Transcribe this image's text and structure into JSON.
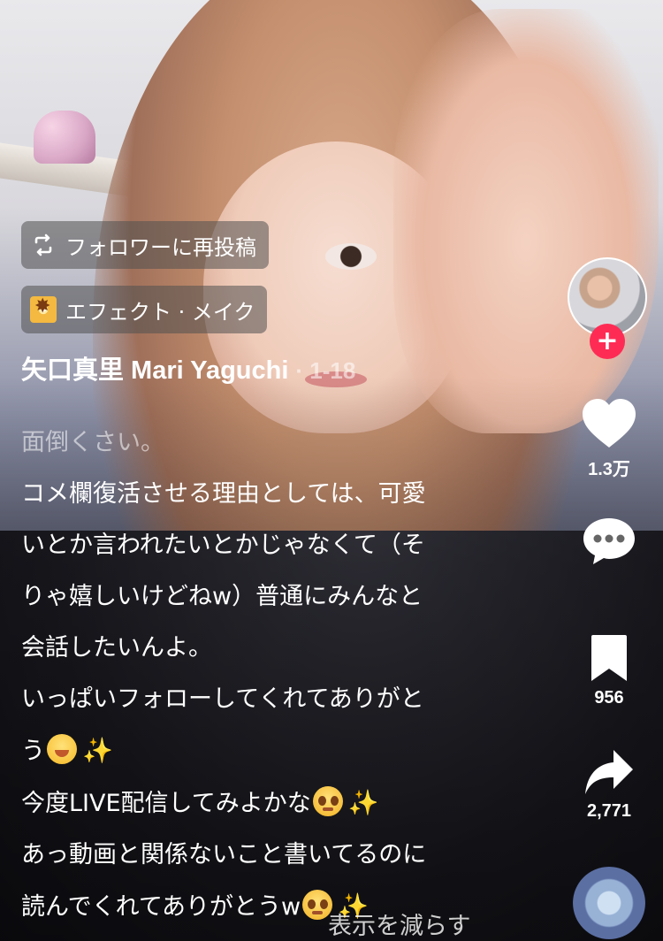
{
  "repost_chip": {
    "label": "フォロワーに再投稿",
    "icon": "repost-icon"
  },
  "effect_chip": {
    "label": "エフェクト · メイク",
    "icon": "effect-icon"
  },
  "author": {
    "name": "矢口真里 Mari Yaguchi",
    "date": "· 1-18"
  },
  "caption": {
    "lines": [
      "面倒くさい。",
      "コメ欄復活させる理由としては、可愛",
      "いとか言われたいとかじゃなくて（そ",
      "りゃ嬉しいけどねw）普通にみんなと",
      "会話したいんよ。",
      "いっぱいフォローしてくれてありがと",
      "う",
      "今度LIVE配信してみよかな",
      "あっ動画と関係ないこと書いてるのに",
      "読んでくれてありがとうw"
    ],
    "emojis": {
      "smile": "😊",
      "sparkles": "✨",
      "teary": "🥹"
    }
  },
  "show_less": "表示を減らす",
  "rail": {
    "follow_symbol": "+",
    "like_count": "1.3万",
    "save_count": "956",
    "share_count": "2,771"
  },
  "colors": {
    "follow_red": "#fe2c55",
    "effect_yellow": "#f4b940"
  }
}
